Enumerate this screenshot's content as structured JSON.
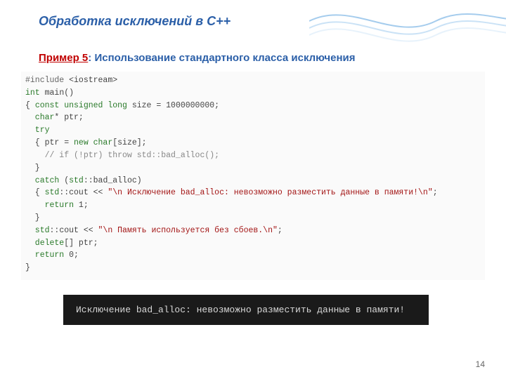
{
  "header": {
    "title": "Обработка исключений в С++"
  },
  "subtitle": {
    "example_label": "Пример 5",
    "sep": ": ",
    "text": "Использование стандартного класса исключения"
  },
  "code": {
    "l1a": "#include ",
    "l1b": "<iostream>",
    "l2a": "int",
    "l2b": " main()",
    "l3a": "{ ",
    "l3b": "const unsigned long",
    "l3c": " size = 1000000000;",
    "l4a": "  char",
    "l4b": "* ptr;",
    "l5": "  try",
    "l6a": "  { ptr = ",
    "l6b": "new char",
    "l6c": "[size];",
    "l7": "    // if (!ptr) throw std::bad_alloc();",
    "l8": "  }",
    "l9a": "  catch",
    "l9b": " (",
    "l9c": "std",
    "l9d": "::bad_alloc)",
    "l10a": "  { ",
    "l10b": "std",
    "l10c": "::cout << ",
    "l10d": "\"\\n Исключение bad_alloc: невозможно разместить данные в памяти!\\n\"",
    "l10e": ";",
    "l11a": "    return",
    "l11b": " 1;",
    "l12": "  }",
    "l13a": "  std",
    "l13b": "::cout << ",
    "l13c": "\"\\n Память используется без сбоев.\\n\"",
    "l13d": ";",
    "l14a": "  delete",
    "l14b": "[] ptr;",
    "l15a": "  return",
    "l15b": " 0;",
    "l16": "}"
  },
  "console": {
    "output": "Исключение bad_alloc: невозможно разместить данные в памяти!"
  },
  "page_number": "14"
}
